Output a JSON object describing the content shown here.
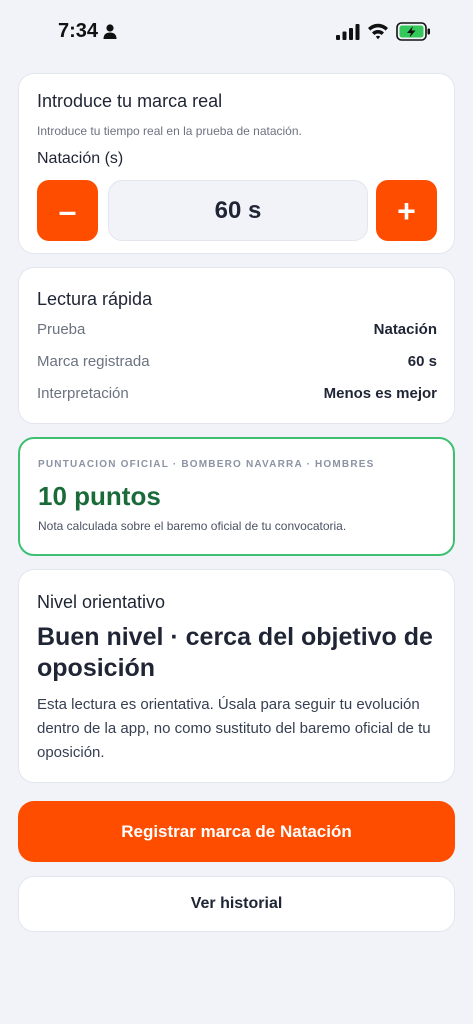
{
  "status_bar": {
    "time": "7:34"
  },
  "input_card": {
    "title": "Introduce tu marca real",
    "subtitle": "Introduce tu tiempo real en la prueba de natación.",
    "field_label": "Natación (s)",
    "minus_label": "–",
    "plus_label": "+",
    "value": "60 s"
  },
  "summary_card": {
    "title": "Lectura rápida",
    "rows": [
      {
        "label": "Prueba",
        "value": "Natación"
      },
      {
        "label": "Marca registrada",
        "value": "60 s"
      },
      {
        "label": "Interpretación",
        "value": "Menos es mejor"
      }
    ]
  },
  "score_card": {
    "eyebrow": "PUNTUACION OFICIAL · BOMBERO NAVARRA · HOMBRES",
    "score": "10 puntos",
    "note": "Nota calculada sobre el baremo oficial de tu convocatoria.",
    "accent_color": "#3fbf72",
    "score_color": "#1b6b3a"
  },
  "level_card": {
    "title": "Nivel orientativo",
    "heading": "Buen nivel · cerca del objetivo de oposición",
    "body": "Esta lectura es orientativa. Úsala para seguir tu evolución dentro de la app, no como sustituto del baremo oficial de tu oposición."
  },
  "actions": {
    "primary_label": "Registrar marca de Natación",
    "secondary_label": "Ver historial"
  },
  "colors": {
    "brand": "#ff4d00",
    "background": "#f1f3f8"
  }
}
